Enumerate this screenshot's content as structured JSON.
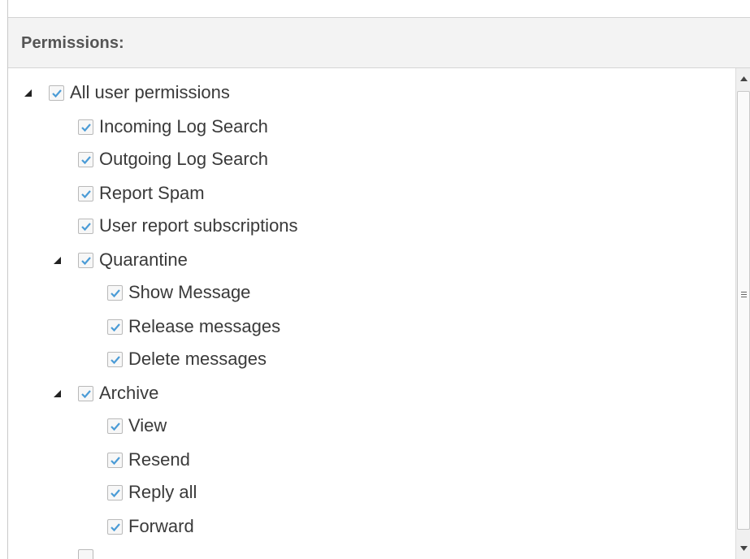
{
  "panel": {
    "title": "Permissions:"
  },
  "tree": [
    {
      "label": "All user permissions",
      "checked": true,
      "expanded": true,
      "level": 0
    },
    {
      "label": "Incoming Log Search",
      "checked": true,
      "level": 1
    },
    {
      "label": "Outgoing Log Search",
      "checked": true,
      "level": 1
    },
    {
      "label": "Report Spam",
      "checked": true,
      "level": 1
    },
    {
      "label": "User report subscriptions",
      "checked": true,
      "level": 1
    },
    {
      "label": "Quarantine",
      "checked": true,
      "expanded": true,
      "level": 1
    },
    {
      "label": "Show Message",
      "checked": true,
      "level": 2
    },
    {
      "label": "Release messages",
      "checked": true,
      "level": 2
    },
    {
      "label": "Delete messages",
      "checked": true,
      "level": 2
    },
    {
      "label": "Archive",
      "checked": true,
      "expanded": true,
      "level": 1
    },
    {
      "label": "View",
      "checked": true,
      "level": 2
    },
    {
      "label": "Resend",
      "checked": true,
      "level": 2
    },
    {
      "label": "Reply all",
      "checked": true,
      "level": 2
    },
    {
      "label": "Forward",
      "checked": true,
      "level": 2
    }
  ],
  "icons": {
    "expander": "triangle-expanded-icon",
    "checkbox": "checkmark-icon",
    "scroll_up": "arrow-up-icon",
    "scroll_down": "arrow-down-icon"
  },
  "colors": {
    "check": "#4a9bd6",
    "header_bg": "#f3f3f3",
    "text": "#3a3a3a"
  }
}
